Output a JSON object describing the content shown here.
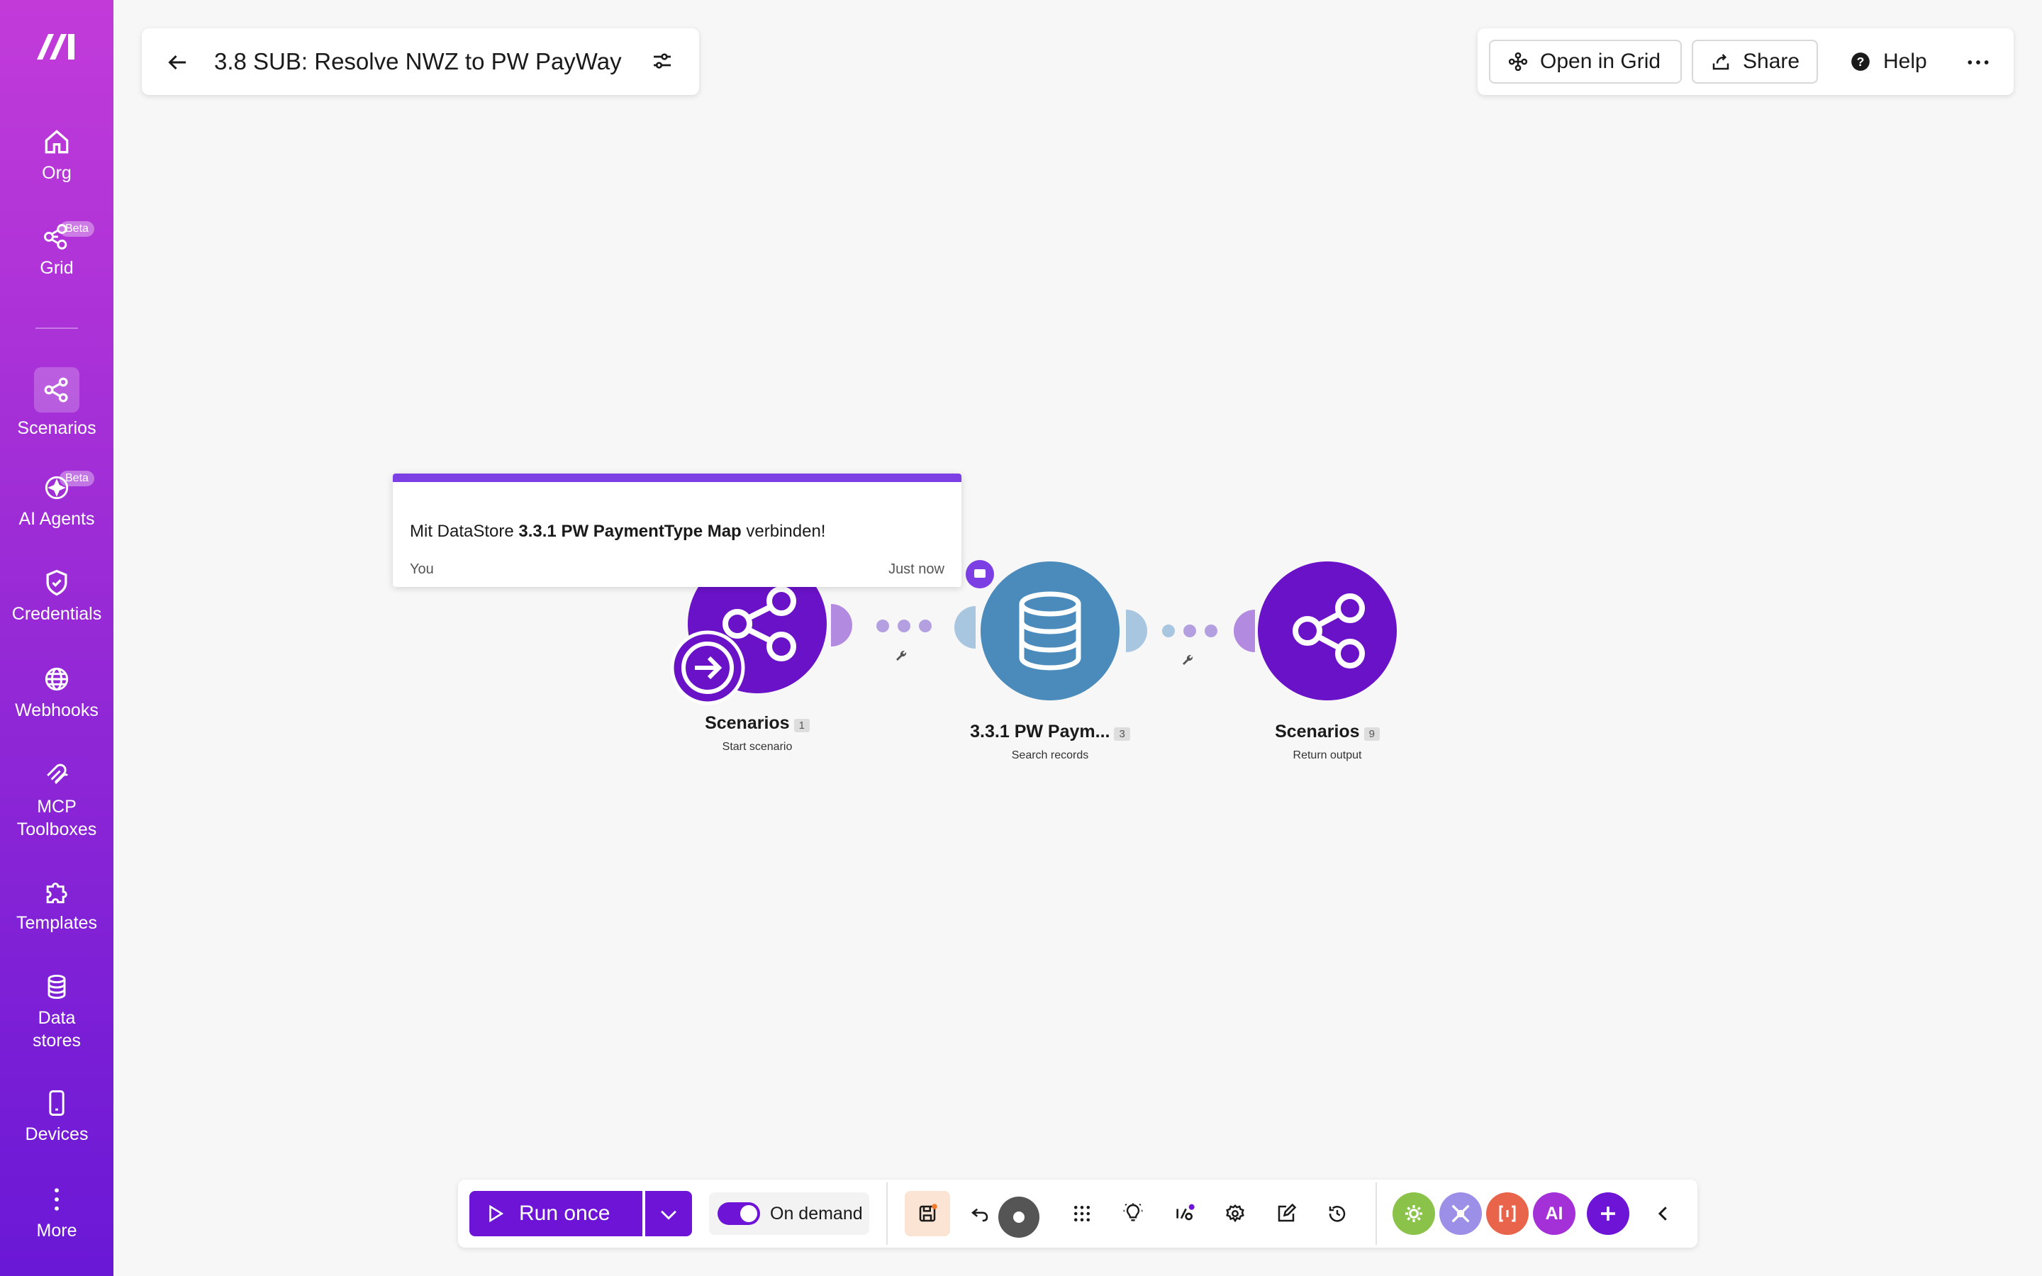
{
  "sidebar": {
    "items": [
      {
        "label": "Org",
        "icon": "home-icon"
      },
      {
        "label": "Grid",
        "icon": "grid-network-icon",
        "badge": "Beta"
      },
      {
        "label": "Scenarios",
        "icon": "share-icon"
      },
      {
        "label": "AI Agents",
        "icon": "ai-agent-icon",
        "badge": "Beta"
      },
      {
        "label": "Credentials",
        "icon": "shield-icon"
      },
      {
        "label": "Webhooks",
        "icon": "globe-icon"
      },
      {
        "label": "MCP\nToolboxes",
        "label_line1": "MCP",
        "label_line2": "Toolboxes",
        "icon": "mcp-icon"
      },
      {
        "label": "Templates",
        "icon": "puzzle-icon"
      },
      {
        "label": "Data stores",
        "label_line1": "Data",
        "label_line2": "stores",
        "icon": "database-icon"
      },
      {
        "label": "Devices",
        "icon": "phone-icon"
      },
      {
        "label": "More",
        "icon": "more-vertical-icon"
      }
    ]
  },
  "header": {
    "title": "3.8 SUB: Resolve NWZ to PW PayWay",
    "open_in_grid": "Open in Grid",
    "share": "Share",
    "help": "Help"
  },
  "note": {
    "prefix": "Mit DataStore ",
    "bold": "3.3.1 PW PaymentType Map",
    "suffix": " verbinden!",
    "author": "You",
    "time": "Just now"
  },
  "modules": [
    {
      "name": "Scenarios",
      "count": "1",
      "sub": "Start scenario"
    },
    {
      "name": "3.3.1 PW Paym...",
      "count": "3",
      "sub": "Search records"
    },
    {
      "name": "Scenarios",
      "count": "9",
      "sub": "Return output"
    }
  ],
  "toolbar": {
    "run_once": "Run once",
    "on_demand": "On demand",
    "ai_label": "AI"
  },
  "colors": {
    "accent": "#6d14d6",
    "scenario_module": "#6a12c8",
    "datastore_module": "#4a8bbb",
    "note_border": "#7b3fe4"
  }
}
